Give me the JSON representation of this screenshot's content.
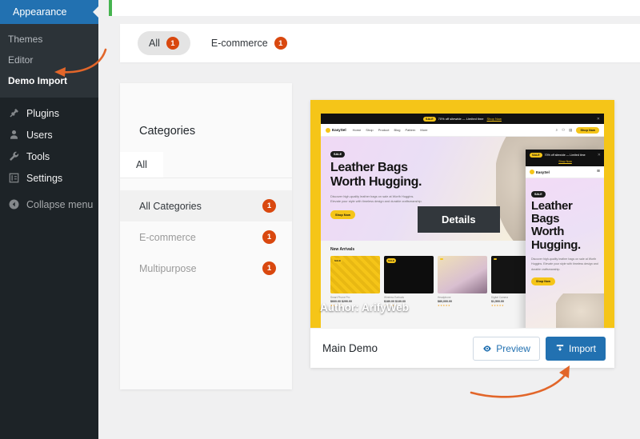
{
  "colors": {
    "wp_blue": "#2271b1",
    "badge_orange": "#d9480f",
    "annotation_orange": "#e2662a",
    "sidebar_dark": "#1d2327",
    "submenu_dark": "#2c3338",
    "notice_green": "#46b450",
    "demo_yellow": "#f5c518"
  },
  "sidebar": {
    "current_menu": {
      "label": "Appearance",
      "icon": "paintbrush-icon"
    },
    "submenu": [
      {
        "label": "Themes",
        "current": false
      },
      {
        "label": "Editor",
        "current": false
      },
      {
        "label": "Demo Import",
        "current": true
      }
    ],
    "items": [
      {
        "label": "Plugins",
        "icon": "plug-icon"
      },
      {
        "label": "Users",
        "icon": "user-icon"
      },
      {
        "label": "Tools",
        "icon": "wrench-icon"
      },
      {
        "label": "Settings",
        "icon": "sliders-icon"
      }
    ],
    "collapse": {
      "label": "Collapse menu",
      "icon": "chevron-left-circle-icon"
    }
  },
  "tabs": [
    {
      "label": "All",
      "count": "1",
      "active": true
    },
    {
      "label": "E-commerce",
      "count": "1",
      "active": false
    }
  ],
  "categories": {
    "title": "Categories",
    "tab": {
      "label": "All"
    },
    "items": [
      {
        "label": "All Categories",
        "count": "1",
        "active": true
      },
      {
        "label": "E-commerce",
        "count": "1",
        "active": false
      },
      {
        "label": "Multipurpose",
        "count": "1",
        "active": false
      }
    ]
  },
  "demo_card": {
    "title": "Main Demo",
    "author_overlay": "Author: ArifyWeb",
    "details_overlay": "Details",
    "preview_button": {
      "label": "Preview",
      "icon": "eye-icon"
    },
    "import_button": {
      "label": "Import",
      "icon": "import-icon"
    },
    "preview_site": {
      "announce_tag": "SALE",
      "announce_text": "70% off sitewide — Limited time",
      "announce_link": "Shop Now",
      "brand": "EasySel",
      "nav": [
        "Home",
        "Shop",
        "Product",
        "Blog",
        "Pattern",
        "More"
      ],
      "nav_cta": "Shop Now",
      "hero_tag": "SALE",
      "hero_heading_line1": "Leather Bags",
      "hero_heading_line2": "Worth Hugging.",
      "hero_text": "Discover high-quality leather bags on sale at Worth Huggins. Elevate your style with timeless design and durable craftsmanship.",
      "hero_cta": "Shop Now",
      "arrivals_title": "New Arrivals",
      "products": [
        {
          "tag": "SALE",
          "name": "Smart Phone Pro",
          "price": "$660.00 $290.00",
          "stars": "★★★★★"
        },
        {
          "tag": "SALE",
          "name": "Wireless Earbuds",
          "price": "$180.00 $130.00",
          "stars": "★★★★★"
        },
        {
          "tag": "",
          "name": "Headphone",
          "price": "$80,000.00",
          "stars": "★★★★★"
        },
        {
          "tag": "",
          "name": "Digital Camera",
          "price": "$1,500.00",
          "stars": "★★★★★"
        }
      ],
      "mobile": {
        "announce_tag": "SALE",
        "announce_text": "70% off sitewide — Limited time",
        "announce_link": "Shop Now",
        "brand": "EasySel",
        "hero_tag": "SALE",
        "hero_heading_line1": "Leather",
        "hero_heading_line2": "Bags",
        "hero_heading_line3": "Worth",
        "hero_heading_line4": "Hugging.",
        "hero_text": "Discover high-quality leather bags on sale at Worth Huggins. Elevate your style with timeless design and durable craftsmanship.",
        "hero_cta": "Shop Now"
      }
    }
  },
  "annotations": [
    {
      "name": "arrow-to-demo-import",
      "points_to": "Demo Import"
    },
    {
      "name": "arrow-to-import-button",
      "points_to": "Import"
    }
  ]
}
